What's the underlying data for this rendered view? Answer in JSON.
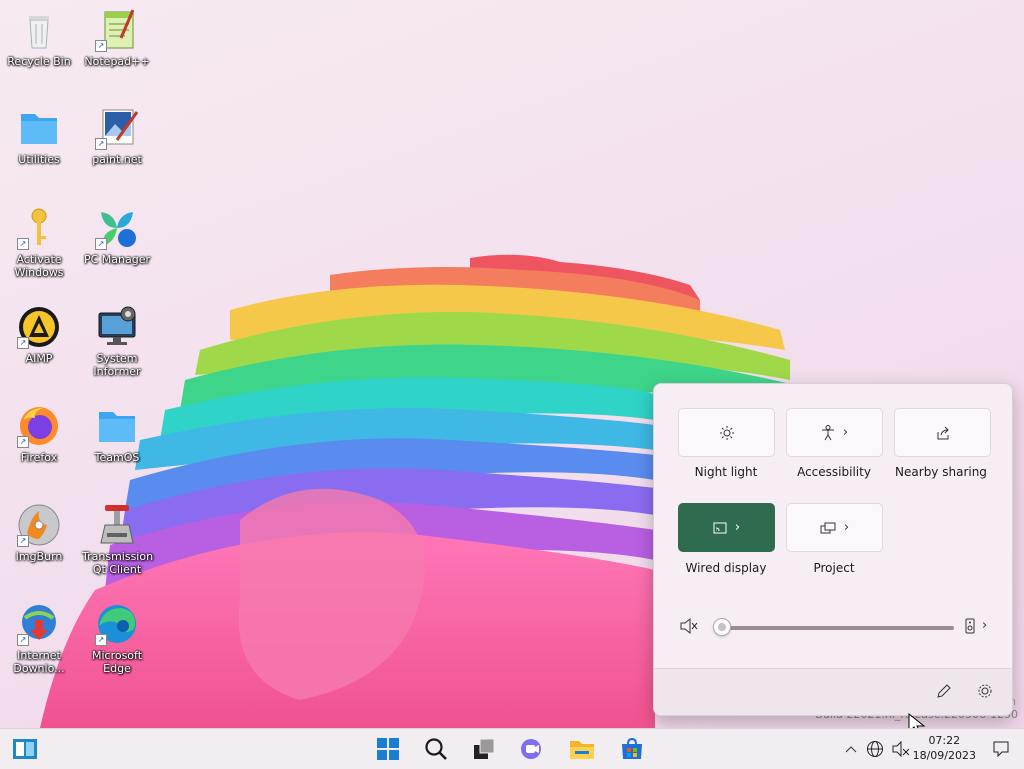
{
  "desktop": {
    "icons": [
      {
        "label": "Recycle Bin",
        "icon": "recycle-bin-icon"
      },
      {
        "label": "Notepad++",
        "icon": "notepadpp-icon"
      },
      {
        "label": "Utilities",
        "icon": "folder-icon"
      },
      {
        "label": "paint.net",
        "icon": "paintnet-icon"
      },
      {
        "label": "Activate Windows",
        "icon": "key-icon"
      },
      {
        "label": "PC Manager",
        "icon": "pc-manager-icon"
      },
      {
        "label": "AIMP",
        "icon": "aimp-icon"
      },
      {
        "label": "System Informer",
        "icon": "system-informer-icon"
      },
      {
        "label": "Firefox",
        "icon": "firefox-icon"
      },
      {
        "label": "TeamOS",
        "icon": "folder-icon"
      },
      {
        "label": "ImgBurn",
        "icon": "imgburn-icon"
      },
      {
        "label": "Transmission Qt Client",
        "icon": "transmission-icon"
      },
      {
        "label": "Internet Downlo...",
        "icon": "idm-icon"
      },
      {
        "label": "Microsoft Edge",
        "icon": "edge-icon"
      }
    ],
    "watermark_line1": "n",
    "watermark_line2": "Build 22621.ni_release.220506-1250"
  },
  "quick_settings": {
    "tiles": [
      {
        "label": "Night light",
        "icon": "brightness-icon",
        "active": false,
        "has_chevron": false
      },
      {
        "label": "Accessibility",
        "icon": "accessibility-icon",
        "active": false,
        "has_chevron": true
      },
      {
        "label": "Nearby sharing",
        "icon": "share-icon",
        "active": false,
        "has_chevron": false
      },
      {
        "label": "Wired display",
        "icon": "cast-icon",
        "active": true,
        "has_chevron": true
      },
      {
        "label": "Project",
        "icon": "project-icon",
        "active": false,
        "has_chevron": true
      }
    ],
    "volume": {
      "muted": true,
      "level": 0
    },
    "footer": {
      "edit": "pencil-icon",
      "settings": "gear-icon"
    },
    "accent_color": "#2f6b4f"
  },
  "taskbar": {
    "widgets": "widgets-icon",
    "apps": [
      "windows-start-icon",
      "search-icon",
      "task-view-icon",
      "chat-icon",
      "file-explorer-icon",
      "store-icon"
    ],
    "tray": [
      "chevron-up-icon",
      "network-icon",
      "volume-muted-icon"
    ],
    "time": "07:22",
    "date": "18/09/2023"
  }
}
